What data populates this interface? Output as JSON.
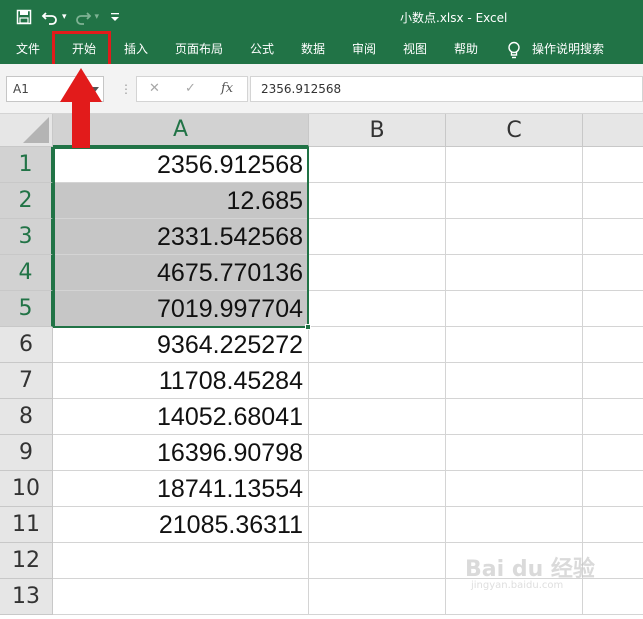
{
  "window": {
    "title": "小数点.xlsx  -  Excel"
  },
  "ribbon": {
    "tabs": [
      {
        "label": "文件"
      },
      {
        "label": "开始"
      },
      {
        "label": "插入"
      },
      {
        "label": "页面布局"
      },
      {
        "label": "公式"
      },
      {
        "label": "数据"
      },
      {
        "label": "审阅"
      },
      {
        "label": "视图"
      },
      {
        "label": "帮助"
      },
      {
        "label": "操作说明搜索"
      }
    ]
  },
  "formula_bar": {
    "name_box": "A1",
    "cancel_glyph": "✕",
    "enter_glyph": "✓",
    "fx_glyph": "fx",
    "value": "2356.912568"
  },
  "sheet": {
    "columns": [
      "A",
      "B",
      "C"
    ],
    "rows": [
      {
        "num": "1",
        "a": "2356.912568"
      },
      {
        "num": "2",
        "a": "12.685"
      },
      {
        "num": "3",
        "a": "2331.542568"
      },
      {
        "num": "4",
        "a": "4675.770136"
      },
      {
        "num": "5",
        "a": "7019.997704"
      },
      {
        "num": "6",
        "a": "9364.225272"
      },
      {
        "num": "7",
        "a": "11708.45284"
      },
      {
        "num": "8",
        "a": "14052.68041"
      },
      {
        "num": "9",
        "a": "16396.90798"
      },
      {
        "num": "10",
        "a": "18741.13554"
      },
      {
        "num": "11",
        "a": "21085.36311"
      },
      {
        "num": "12",
        "a": ""
      },
      {
        "num": "13",
        "a": ""
      }
    ]
  },
  "watermark": {
    "brand": "Bai du 经验",
    "url": "jingyan.baidu.com"
  },
  "colors": {
    "excel_green": "#217346",
    "annotation_red": "#e21b1b"
  }
}
